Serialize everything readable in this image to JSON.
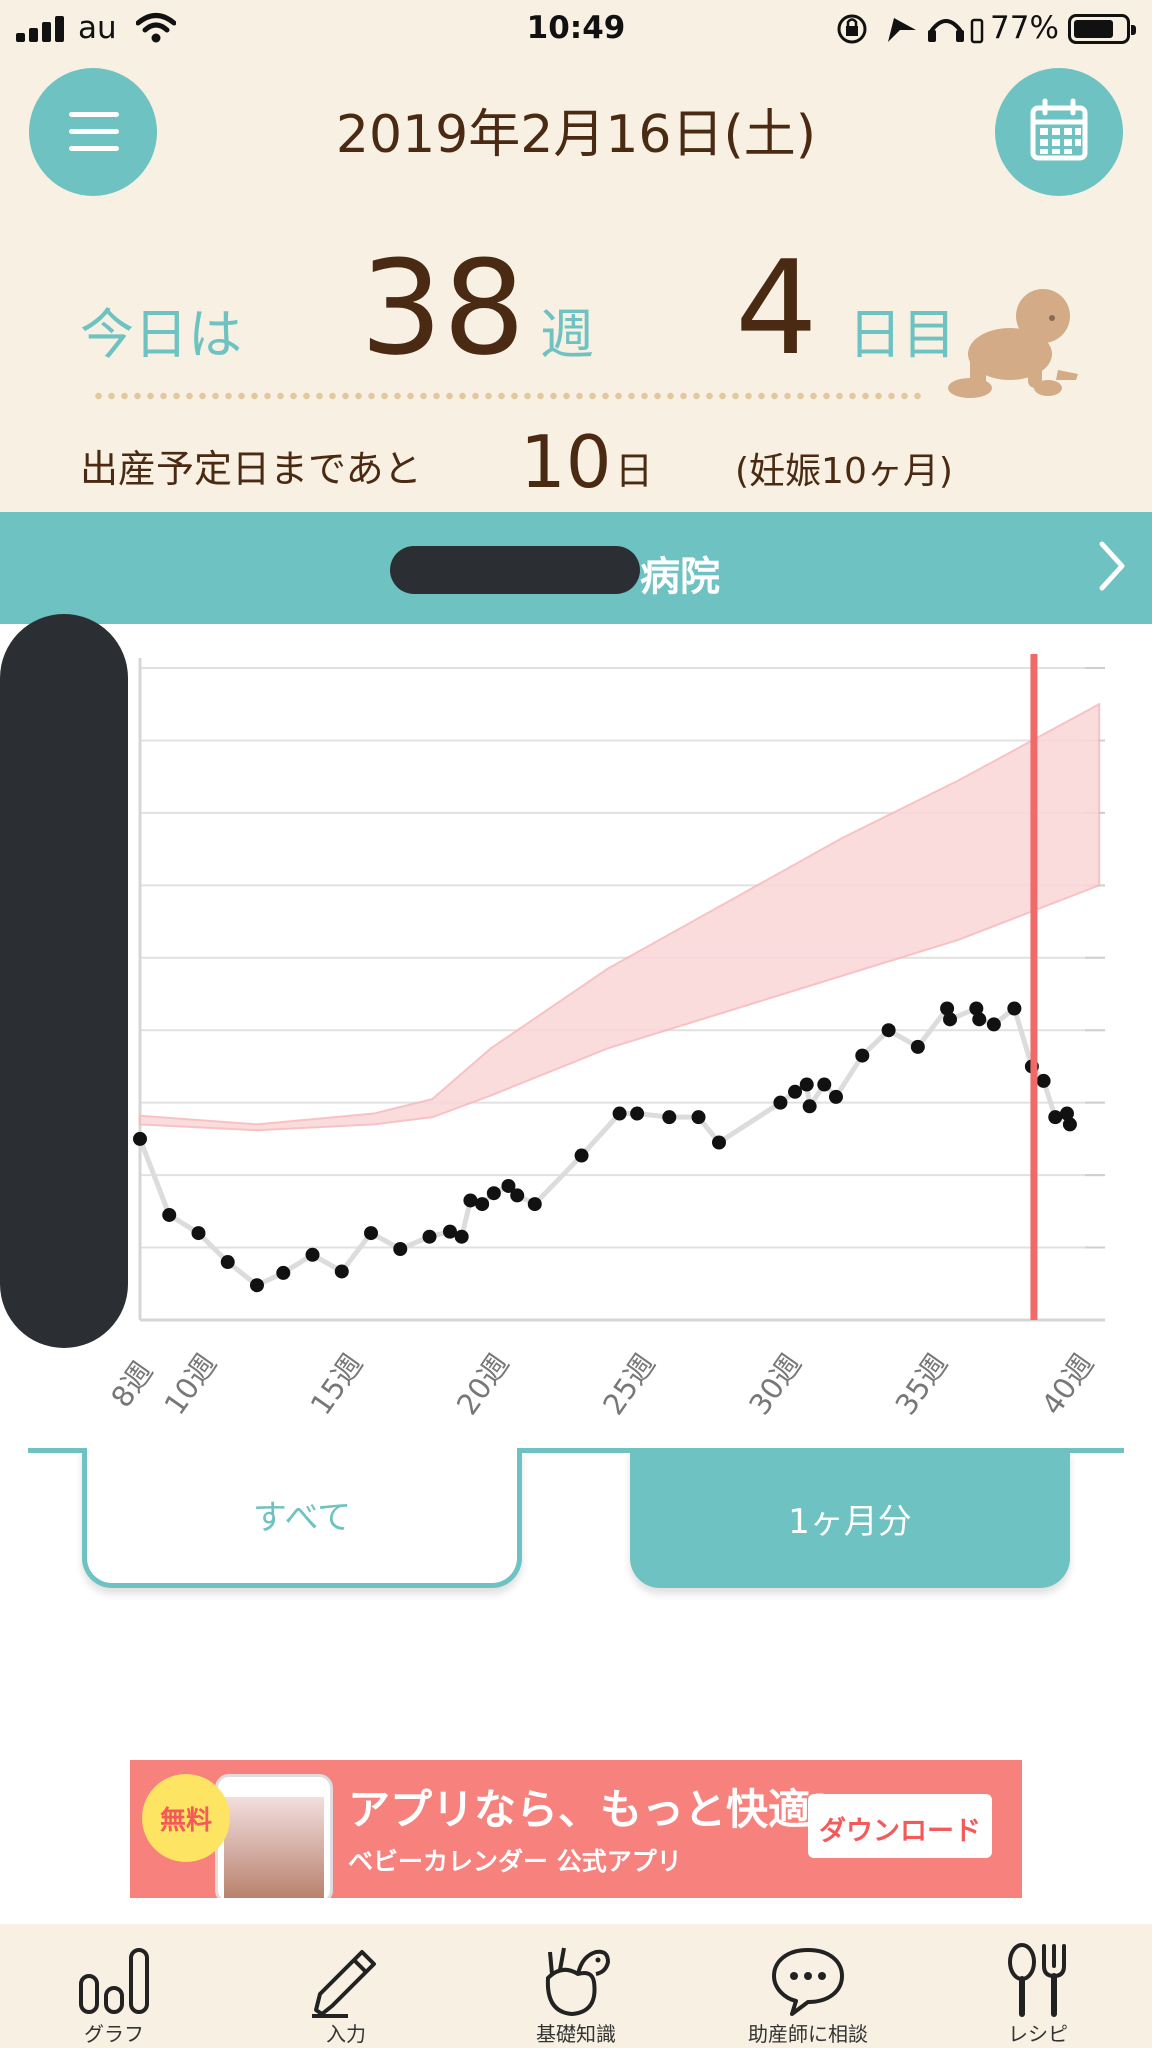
{
  "status_bar": {
    "carrier": "au",
    "time": "10:49",
    "battery_percent": "77%",
    "battery_level": 0.77
  },
  "header": {
    "date": "2019年2月16日(土)",
    "today_label": "今日は",
    "week_value": "38",
    "week_unit": "週",
    "day_value": "4",
    "day_unit": "日目",
    "remaining_label": "出産予定日まであと",
    "remaining_value": "10",
    "remaining_unit": "日",
    "month_label": "(妊娠10ヶ月)"
  },
  "icons": {
    "menu": "hamburger-icon",
    "calendar": "calendar-icon",
    "mascot": "baby-crawling-icon",
    "arrow": "chevron-right-icon"
  },
  "hospital": {
    "name_suffix": "病院"
  },
  "chart_data": {
    "type": "line",
    "x_tick_labels": [
      "8週",
      "10週",
      "15週",
      "20週",
      "25週",
      "30週",
      "35週",
      "40週"
    ],
    "x_ticks": [
      8,
      10,
      15,
      20,
      25,
      30,
      35,
      40
    ],
    "xlim": [
      8,
      41
    ],
    "ylim": [
      0,
      9
    ],
    "grid": true,
    "current_week_marker": 38.57,
    "marker_color": "#f06a6a",
    "band_color": "#fbd6d8",
    "series": [
      {
        "type": "scatter-line",
        "color": "#111111",
        "points": [
          [
            8.0,
            2.5
          ],
          [
            9.0,
            1.45
          ],
          [
            10.0,
            1.2
          ],
          [
            11.0,
            0.8
          ],
          [
            12.0,
            0.48
          ],
          [
            12.9,
            0.65
          ],
          [
            13.9,
            0.9
          ],
          [
            14.9,
            0.67
          ],
          [
            15.9,
            1.2
          ],
          [
            16.9,
            0.98
          ],
          [
            17.9,
            1.15
          ],
          [
            18.6,
            1.22
          ],
          [
            19.0,
            1.15
          ],
          [
            19.3,
            1.65
          ],
          [
            19.7,
            1.6
          ],
          [
            20.1,
            1.75
          ],
          [
            20.6,
            1.85
          ],
          [
            20.9,
            1.72
          ],
          [
            21.5,
            1.6
          ],
          [
            23.1,
            2.27
          ],
          [
            24.4,
            2.85
          ],
          [
            25.0,
            2.85
          ],
          [
            26.1,
            2.8
          ],
          [
            27.1,
            2.8
          ],
          [
            27.8,
            2.45
          ],
          [
            29.9,
            3.0
          ],
          [
            30.4,
            3.15
          ],
          [
            30.8,
            3.25
          ],
          [
            30.9,
            2.95
          ],
          [
            31.4,
            3.25
          ],
          [
            31.8,
            3.08
          ],
          [
            32.7,
            3.65
          ],
          [
            33.6,
            4.0
          ],
          [
            34.6,
            3.77
          ],
          [
            35.6,
            4.3
          ],
          [
            35.7,
            4.15
          ],
          [
            36.6,
            4.3
          ],
          [
            36.7,
            4.15
          ],
          [
            37.2,
            4.08
          ],
          [
            37.9,
            4.3
          ],
          [
            38.5,
            3.5
          ],
          [
            38.9,
            3.3
          ],
          [
            39.3,
            2.8
          ],
          [
            39.7,
            2.85
          ],
          [
            39.8,
            2.7
          ]
        ]
      }
    ],
    "reference_band": {
      "weeks": [
        8,
        12,
        16,
        18,
        20,
        24,
        28,
        32,
        36,
        40.8
      ],
      "lower": [
        2.7,
        2.62,
        2.7,
        2.8,
        3.1,
        3.75,
        4.25,
        4.75,
        5.25,
        6.0
      ],
      "upper": [
        2.82,
        2.7,
        2.85,
        3.05,
        3.75,
        4.85,
        5.75,
        6.65,
        7.45,
        8.5
      ]
    }
  },
  "tabs": {
    "all": "すべて",
    "one_month": "1ヶ月分"
  },
  "banner": {
    "badge": "無料",
    "title": "アプリなら、もっと快適!",
    "subtitle": "ベビーカレンダー 公式アプリ",
    "button": "ダウンロード"
  },
  "bottom_nav": [
    {
      "label": "グラフ",
      "icon": "bar-chart-icon"
    },
    {
      "label": "入力",
      "icon": "pencil-icon"
    },
    {
      "label": "基礎知識",
      "icon": "stork-icon"
    },
    {
      "label": "助産師に相談",
      "icon": "chat-bubble-icon"
    },
    {
      "label": "レシピ",
      "icon": "fork-spoon-icon"
    }
  ]
}
